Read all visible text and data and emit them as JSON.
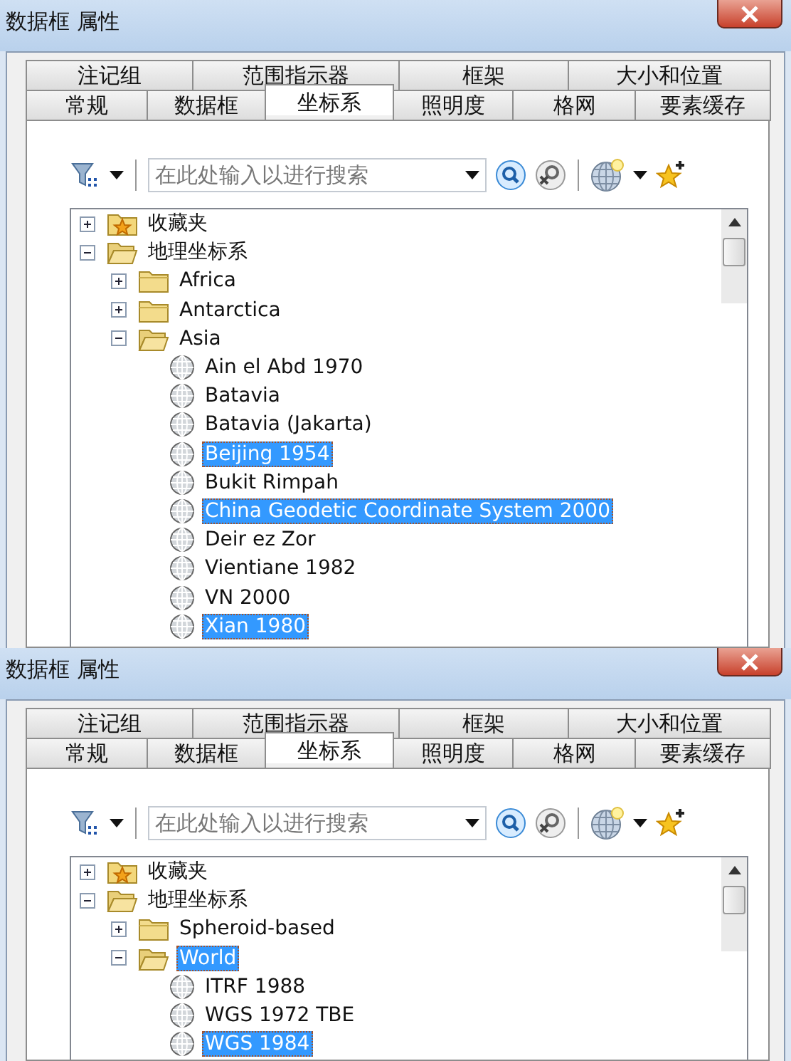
{
  "panels": [
    {
      "window": {
        "title": "数据框 属性"
      },
      "tab_rows": [
        [
          {
            "label": "注记组",
            "selected": false
          },
          {
            "label": "范围指示器",
            "selected": false
          },
          {
            "label": "框架",
            "selected": false
          },
          {
            "label": "大小和位置",
            "selected": false
          }
        ],
        [
          {
            "label": "常规",
            "selected": false
          },
          {
            "label": "数据框",
            "selected": false
          },
          {
            "label": "坐标系",
            "selected": true
          },
          {
            "label": "照明度",
            "selected": false
          },
          {
            "label": "格网",
            "selected": false
          },
          {
            "label": "要素缓存",
            "selected": false
          }
        ]
      ],
      "search": {
        "placeholder": "在此处输入以进行搜索"
      },
      "tree": [
        {
          "kind": "favorites",
          "label": "收藏夹",
          "expanded": false,
          "selected": false
        },
        {
          "kind": "folder",
          "label": "地理坐标系",
          "expanded": true,
          "selected": false,
          "children": [
            {
              "kind": "folder",
              "label": "Africa",
              "expanded": false,
              "selected": false
            },
            {
              "kind": "folder",
              "label": "Antarctica",
              "expanded": false,
              "selected": false
            },
            {
              "kind": "folder",
              "label": "Asia",
              "expanded": true,
              "selected": false,
              "children": [
                {
                  "kind": "gcs",
                  "label": "Ain el Abd 1970",
                  "selected": false
                },
                {
                  "kind": "gcs",
                  "label": "Batavia",
                  "selected": false
                },
                {
                  "kind": "gcs",
                  "label": "Batavia (Jakarta)",
                  "selected": false
                },
                {
                  "kind": "gcs",
                  "label": "Beijing 1954",
                  "selected": true
                },
                {
                  "kind": "gcs",
                  "label": "Bukit Rimpah",
                  "selected": false
                },
                {
                  "kind": "gcs",
                  "label": "China Geodetic Coordinate System 2000",
                  "selected": true
                },
                {
                  "kind": "gcs",
                  "label": "Deir ez Zor",
                  "selected": false
                },
                {
                  "kind": "gcs",
                  "label": "Vientiane 1982",
                  "selected": false
                },
                {
                  "kind": "gcs",
                  "label": "VN 2000",
                  "selected": false
                },
                {
                  "kind": "gcs",
                  "label": "Xian 1980",
                  "selected": true
                }
              ]
            }
          ]
        }
      ]
    },
    {
      "window": {
        "title": "数据框 属性"
      },
      "tab_rows": [
        [
          {
            "label": "注记组",
            "selected": false
          },
          {
            "label": "范围指示器",
            "selected": false
          },
          {
            "label": "框架",
            "selected": false
          },
          {
            "label": "大小和位置",
            "selected": false
          }
        ],
        [
          {
            "label": "常规",
            "selected": false
          },
          {
            "label": "数据框",
            "selected": false
          },
          {
            "label": "坐标系",
            "selected": true
          },
          {
            "label": "照明度",
            "selected": false
          },
          {
            "label": "格网",
            "selected": false
          },
          {
            "label": "要素缓存",
            "selected": false
          }
        ]
      ],
      "search": {
        "placeholder": "在此处输入以进行搜索"
      },
      "tree": [
        {
          "kind": "favorites",
          "label": "收藏夹",
          "expanded": false,
          "selected": false
        },
        {
          "kind": "folder",
          "label": "地理坐标系",
          "expanded": true,
          "selected": false,
          "children": [
            {
              "kind": "folder",
              "label": "Spheroid-based",
              "expanded": false,
              "selected": false
            },
            {
              "kind": "folder",
              "label": "World",
              "expanded": true,
              "selected": true,
              "children": [
                {
                  "kind": "gcs",
                  "label": "ITRF 1988",
                  "selected": false
                },
                {
                  "kind": "gcs",
                  "label": "WGS 1972 TBE",
                  "selected": false
                },
                {
                  "kind": "gcs",
                  "label": "WGS 1984",
                  "selected": true
                }
              ]
            }
          ]
        }
      ]
    }
  ]
}
